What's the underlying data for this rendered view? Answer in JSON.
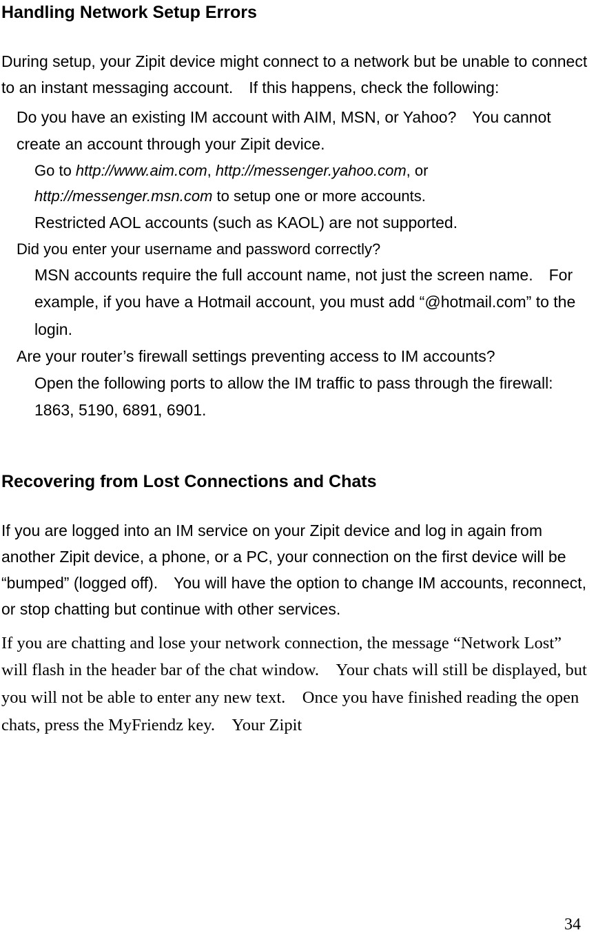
{
  "heading1": "Handling Network Setup Errors",
  "intro1": "During setup, your Zipit device might connect to a network but be unable to connect to an instant messaging account. If this happens, check the following:",
  "item1": "Do you have an existing IM account with AIM, MSN, or Yahoo? You cannot create an account through your Zipit device.",
  "sub1a_pre": "Go to ",
  "sub1a_url1": "http://www.aim.com",
  "sub1a_mid1": ", ",
  "sub1a_url2": "http://messenger.yahoo.com",
  "sub1a_mid2": ", or ",
  "sub1a_url3": "http://messenger.msn.com",
  "sub1a_post": " to setup one or more accounts.",
  "sub1b": "Restricted AOL accounts (such as KAOL) are not supported.",
  "item2": "Did you enter your username and password correctly?",
  "sub2a": "MSN accounts require the full account name, not just the screen name. For example, if you have a Hotmail account, you must add “@hotmail.com” to the login.",
  "item3": "Are your router’s firewall settings preventing access to IM accounts?",
  "sub3a": "Open the following ports to allow the IM traffic to pass through the firewall: 1863, 5190, 6891, 6901.",
  "heading2": "Recovering from Lost Connections and Chats",
  "intro2": "If you are logged into an IM service on your Zipit device and log in again from another Zipit device, a phone, or a PC, your connection on the first device will be “bumped” (logged off). You will have the option to change IM accounts, reconnect, or stop chatting but continue with other services.",
  "para2": "If you are chatting and lose your network connection, the message “Network Lost” will flash in the header bar of the chat window. Your chats will still be displayed, but you will not be able to enter any new text. Once you have finished reading the open chats, press the MyFriendz key. Your Zipit",
  "page_number": "34"
}
